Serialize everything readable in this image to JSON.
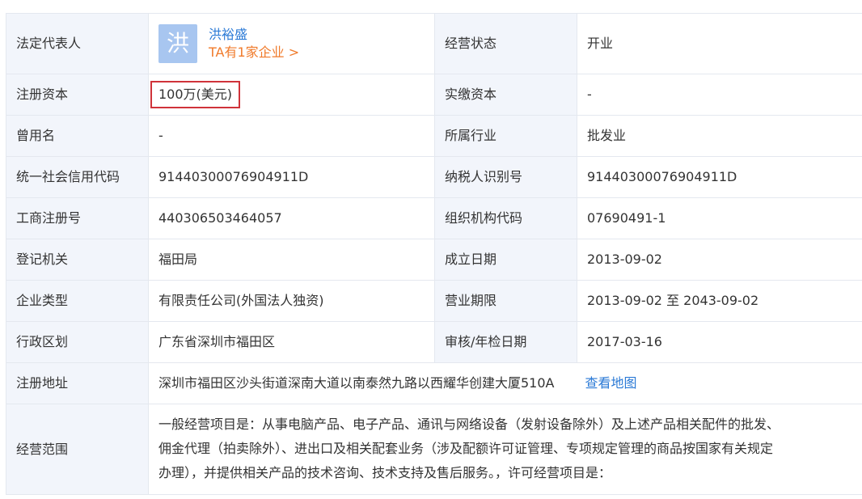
{
  "rows": [
    {
      "l1": "法定代表人",
      "v1_name": "洪裕盛",
      "v1_avatar": "洪",
      "v1_link": "TA有1家企业 >",
      "l2": "经营状态",
      "v2": "开业"
    },
    {
      "l1": "注册资本",
      "v1": "100万(美元)",
      "l2": "实缴资本",
      "v2": "-"
    },
    {
      "l1": "曾用名",
      "v1": "-",
      "l2": "所属行业",
      "v2": "批发业"
    },
    {
      "l1": "统一社会信用代码",
      "v1": "91440300076904911D",
      "l2": "纳税人识别号",
      "v2": "91440300076904911D"
    },
    {
      "l1": "工商注册号",
      "v1": "440306503464057",
      "l2": "组织机构代码",
      "v2": "07690491-1"
    },
    {
      "l1": "登记机关",
      "v1": "福田局",
      "l2": "成立日期",
      "v2": "2013-09-02"
    },
    {
      "l1": "企业类型",
      "v1": "有限责任公司(外国法人独资)",
      "l2": "营业期限",
      "v2": "2013-09-02 至 2043-09-02"
    },
    {
      "l1": "行政区划",
      "v1": "广东省深圳市福田区",
      "l2": "审核/年检日期",
      "v2": "2017-03-16"
    }
  ],
  "address": {
    "label": "注册地址",
    "value": "深圳市福田区沙头街道深南大道以南泰然九路以西耀华创建大厦510A",
    "map_link": "查看地图"
  },
  "scope": {
    "label": "经营范围",
    "line1": "一般经营项目是：从事电脑产品、电子产品、通讯与网络设备（发射设备除外）及上述产品相关配件的批发、",
    "line2": "佣金代理（拍卖除外）、进出口及相关配套业务（涉及配额许可证管理、专项规定管理的商品按国家有关规定",
    "line3": "办理），并提供相关产品的技术咨询、技术支持及售后服务。，许可经营项目是："
  }
}
